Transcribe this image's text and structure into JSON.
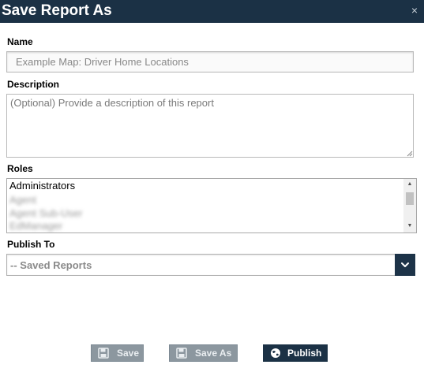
{
  "dialog": {
    "title": "Save Report As",
    "close_glyph": "×"
  },
  "fields": {
    "name": {
      "label": "Name",
      "value": "Example Map: Driver Home Locations"
    },
    "description": {
      "label": "Description",
      "placeholder": "(Optional) Provide a description of this report"
    },
    "roles": {
      "label": "Roles",
      "items": [
        {
          "label": "Administrators",
          "blurred": false
        },
        {
          "label": "Agent",
          "blurred": true
        },
        {
          "label": "Agent Sub-User",
          "blurred": true
        },
        {
          "label": "EdManager",
          "blurred": true
        }
      ]
    },
    "publish_to": {
      "label": "Publish To",
      "selected": "-- Saved Reports"
    }
  },
  "buttons": {
    "save": {
      "label": "Save",
      "icon": "floppy-disk-icon",
      "enabled": false
    },
    "save_as": {
      "label": "Save As",
      "icon": "floppy-disk-icon",
      "enabled": false
    },
    "publish": {
      "label": "Publish",
      "icon": "globe-icon",
      "enabled": true
    }
  },
  "colors": {
    "header_bg": "#1b3145",
    "button_disabled_bg": "#8c979f",
    "button_primary_bg": "#1b3145"
  }
}
